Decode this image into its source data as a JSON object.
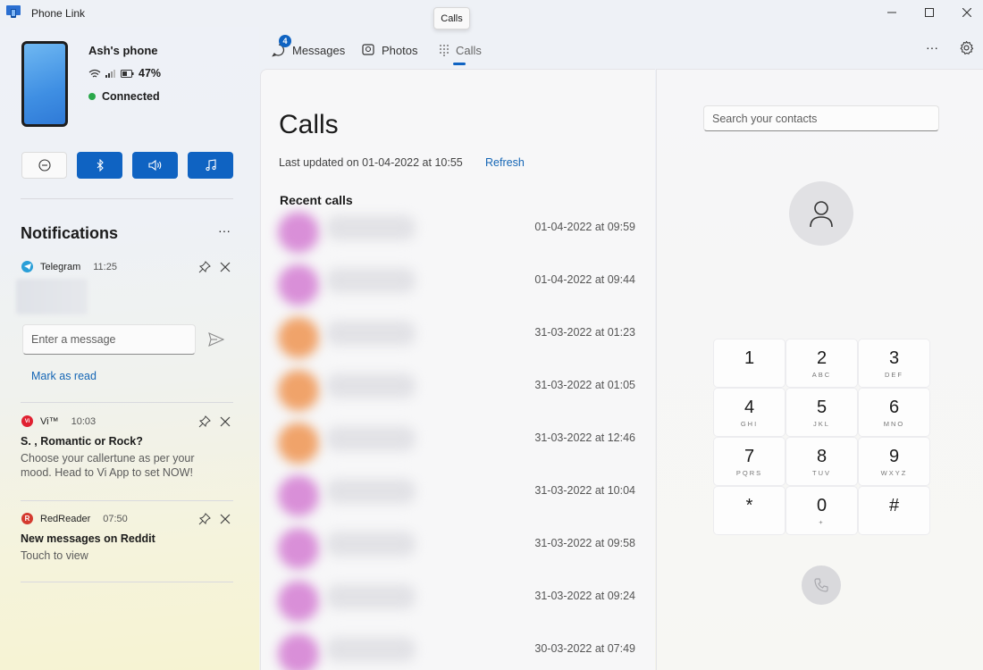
{
  "window": {
    "title": "Phone Link",
    "tooltip": "Calls"
  },
  "device": {
    "name": "Ash's phone",
    "battery": "47%",
    "connection": "Connected"
  },
  "tabs": [
    {
      "label": "Messages",
      "badge": "4"
    },
    {
      "label": "Photos"
    },
    {
      "label": "Calls"
    }
  ],
  "notifications": {
    "title": "Notifications",
    "more": "···",
    "items": [
      {
        "app": "Telegram",
        "time": "11:25",
        "reply_placeholder": "Enter a message",
        "action": "Mark as read"
      },
      {
        "app": "Vi™",
        "time": "10:03",
        "title": "S. , Romantic or Rock?",
        "body": "Choose your callertune as per your mood. Head to Vi App to set NOW!"
      },
      {
        "app": "RedReader",
        "time": "07:50",
        "title": "New messages on Reddit",
        "body": "Touch to view"
      }
    ]
  },
  "calls": {
    "title": "Calls",
    "last_updated": "Last updated on 01-04-2022 at 10:55",
    "refresh": "Refresh",
    "recent_label": "Recent calls",
    "items": [
      {
        "time": "01-04-2022 at 09:59",
        "color": "#d98fd8"
      },
      {
        "time": "01-04-2022 at 09:44",
        "color": "#d98fd8"
      },
      {
        "time": "31-03-2022 at 01:23",
        "color": "#f0a36a"
      },
      {
        "time": "31-03-2022 at 01:05",
        "color": "#f0a36a"
      },
      {
        "time": "31-03-2022 at 12:46",
        "color": "#f0a36a"
      },
      {
        "time": "31-03-2022 at 10:04",
        "color": "#d98fd8"
      },
      {
        "time": "31-03-2022 at 09:58",
        "color": "#d98fd8"
      },
      {
        "time": "31-03-2022 at 09:24",
        "color": "#d98fd8"
      },
      {
        "time": "30-03-2022 at 07:49",
        "color": "#d98fd8"
      }
    ]
  },
  "dialer": {
    "search_placeholder": "Search your contacts",
    "keys": [
      {
        "digit": "1",
        "letters": ""
      },
      {
        "digit": "2",
        "letters": "ABC"
      },
      {
        "digit": "3",
        "letters": "DEF"
      },
      {
        "digit": "4",
        "letters": "GHI"
      },
      {
        "digit": "5",
        "letters": "JKL"
      },
      {
        "digit": "6",
        "letters": "MNO"
      },
      {
        "digit": "7",
        "letters": "PQRS"
      },
      {
        "digit": "8",
        "letters": "TUV"
      },
      {
        "digit": "9",
        "letters": "WXYZ"
      },
      {
        "digit": "*",
        "letters": ""
      },
      {
        "digit": "0",
        "letters": "+"
      },
      {
        "digit": "#",
        "letters": ""
      }
    ]
  },
  "colors": {
    "accent": "#0f63c2",
    "link": "#1566b5",
    "connected": "#2aa84a"
  }
}
